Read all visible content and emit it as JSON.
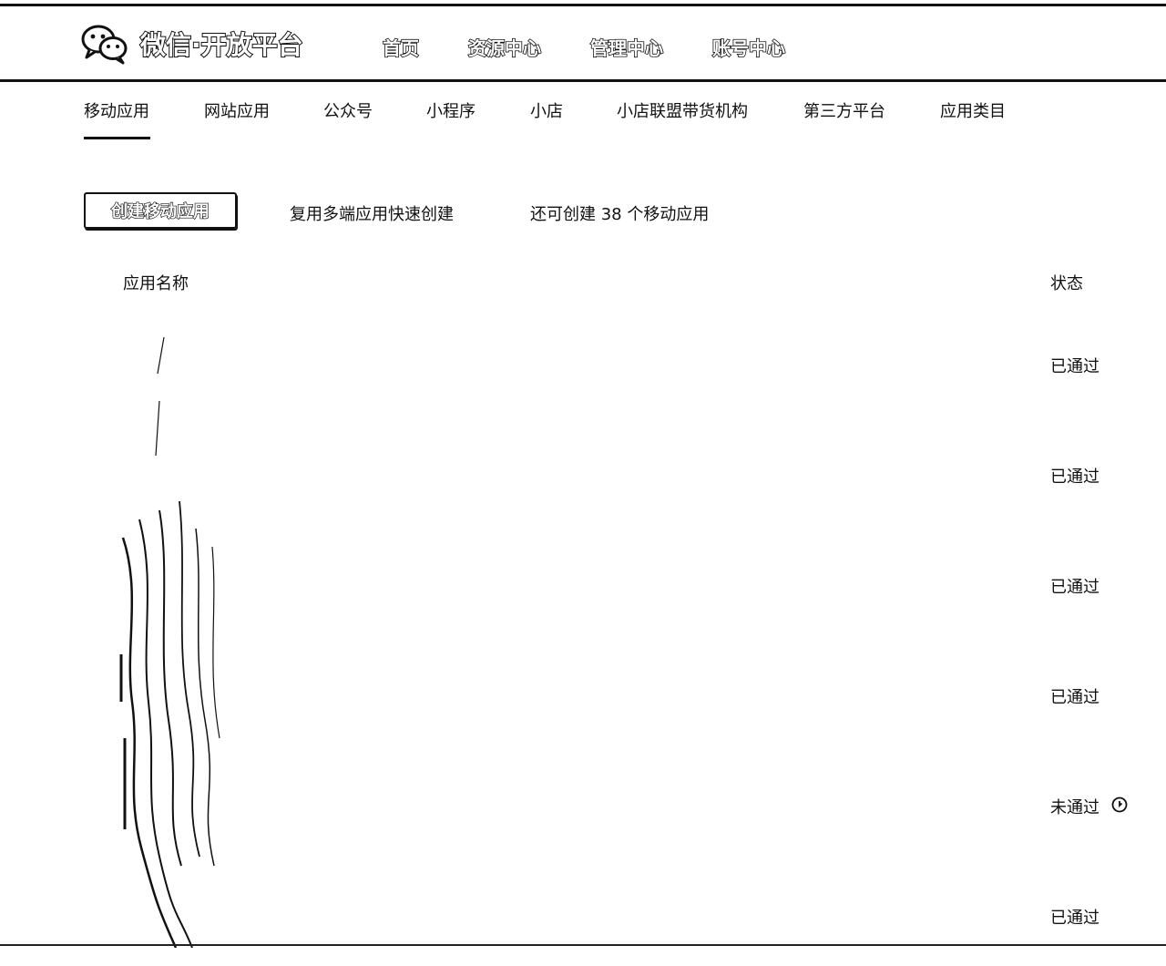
{
  "brand": {
    "title": "微信·开放平台",
    "logo_icon": "wechat-logo-icon"
  },
  "topnav": [
    "首页",
    "资源中心",
    "管理中心",
    "账号中心"
  ],
  "subnav": {
    "tabs": [
      "移动应用",
      "网站应用",
      "公众号",
      "小程序",
      "小店",
      "小店联盟带货机构",
      "第三方平台",
      "应用类目"
    ],
    "active": "移动应用"
  },
  "actions": {
    "create_label": "创建移动应用",
    "reuse_label": "复用多端应用快速创建",
    "remaining_text": "还可创建 38 个移动应用"
  },
  "table": {
    "col_name": "应用名称",
    "col_status": "状态",
    "rows": [
      {
        "name": "",
        "status": "已通过"
      },
      {
        "name": "",
        "status": "已通过"
      },
      {
        "name": "",
        "status": "已通过"
      },
      {
        "name": "",
        "status": "已通过"
      },
      {
        "name": "",
        "status": "未通过",
        "icon": "info-circle-icon"
      },
      {
        "name": "",
        "status": "已通过"
      }
    ]
  }
}
